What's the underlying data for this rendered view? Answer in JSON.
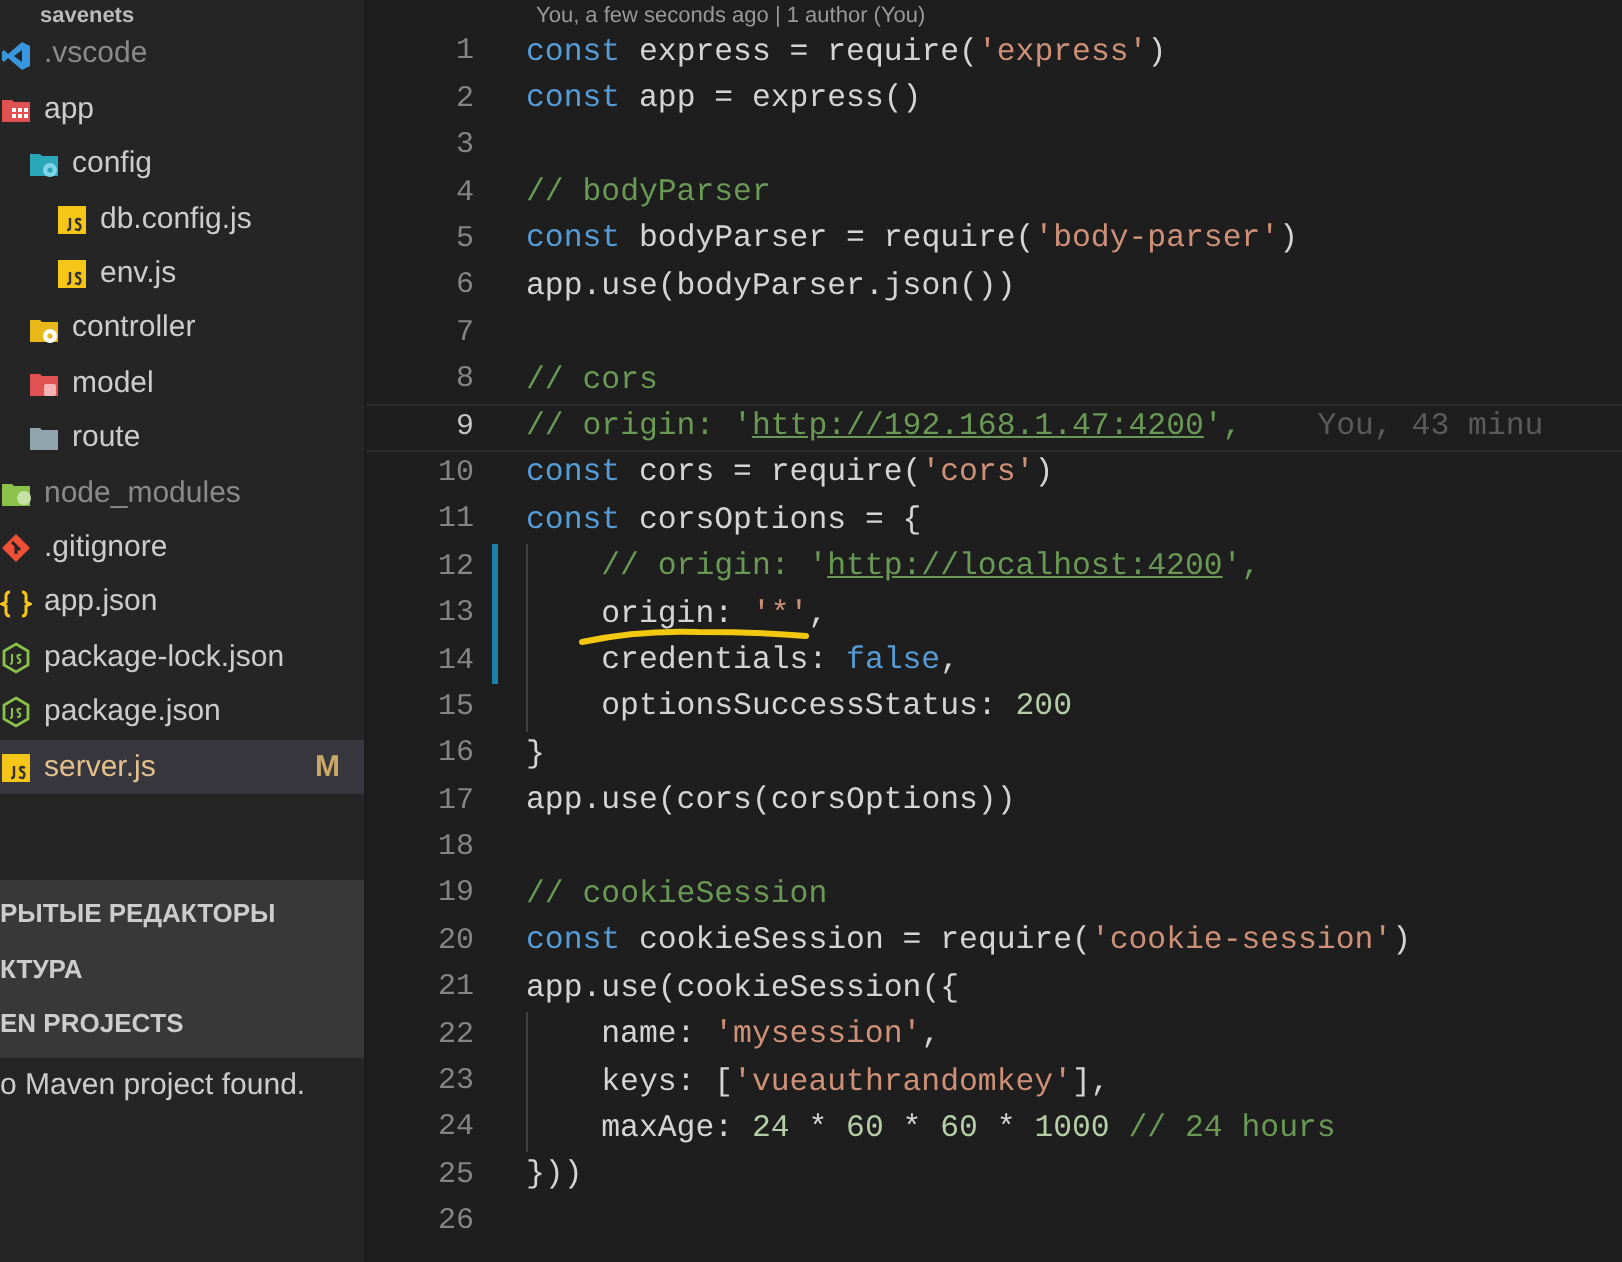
{
  "explorer": {
    "root": "savenets",
    "tree": [
      {
        "label": ".vscode",
        "kind": "vscode",
        "dimmed": true,
        "selected": false
      },
      {
        "label": "app",
        "kind": "folder-app",
        "dimmed": false,
        "selected": false,
        "children": [
          {
            "label": "config",
            "kind": "folder-config",
            "dimmed": false,
            "selected": false,
            "children": [
              {
                "label": "db.config.js",
                "kind": "js",
                "dimmed": false,
                "selected": false
              },
              {
                "label": "env.js",
                "kind": "js",
                "dimmed": false,
                "selected": false
              }
            ]
          },
          {
            "label": "controller",
            "kind": "folder-controller",
            "dimmed": false,
            "selected": false
          },
          {
            "label": "model",
            "kind": "folder-model",
            "dimmed": false,
            "selected": false
          },
          {
            "label": "route",
            "kind": "folder",
            "dimmed": false,
            "selected": false
          }
        ]
      },
      {
        "label": "node_modules",
        "kind": "folder-node",
        "dimmed": true,
        "selected": false
      },
      {
        "label": ".gitignore",
        "kind": "git",
        "dimmed": false,
        "selected": false
      },
      {
        "label": "app.json",
        "kind": "json",
        "dimmed": false,
        "selected": false
      },
      {
        "label": "package-lock.json",
        "kind": "npm",
        "dimmed": false,
        "selected": false
      },
      {
        "label": "package.json",
        "kind": "npm",
        "dimmed": false,
        "selected": false
      },
      {
        "label": "server.js",
        "kind": "js",
        "dimmed": false,
        "selected": true,
        "badge": "M"
      }
    ],
    "sections": [
      "РЫТЫЕ РЕДАКТОРЫ",
      "КТУРА",
      "EN PROJECTS"
    ],
    "maven_message": "o Maven project found."
  },
  "editor": {
    "codelens": "You, a few seconds ago | 1 author (You)",
    "lines": [
      {
        "number": "1",
        "current": false,
        "modified": false,
        "tokens": [
          {
            "kind": "kw",
            "text": "const"
          },
          {
            "kind": "plain",
            "text": " express = "
          },
          {
            "kind": "plain",
            "text": "require"
          },
          {
            "kind": "plain",
            "text": "("
          },
          {
            "kind": "str",
            "text": "'express'"
          },
          {
            "kind": "plain",
            "text": ")"
          }
        ]
      },
      {
        "number": "2",
        "current": false,
        "modified": false,
        "tokens": [
          {
            "kind": "kw",
            "text": "const"
          },
          {
            "kind": "plain",
            "text": " app = express()"
          }
        ]
      },
      {
        "number": "3",
        "current": false,
        "modified": false
      },
      {
        "number": "4",
        "current": false,
        "modified": false,
        "tokens": [
          {
            "kind": "com",
            "text": "// bodyParser"
          }
        ]
      },
      {
        "number": "5",
        "current": false,
        "modified": false,
        "tokens": [
          {
            "kind": "kw",
            "text": "const"
          },
          {
            "kind": "plain",
            "text": " bodyParser = require("
          },
          {
            "kind": "str",
            "text": "'body-parser'"
          },
          {
            "kind": "plain",
            "text": ")"
          }
        ]
      },
      {
        "number": "6",
        "current": false,
        "modified": false,
        "tokens": [
          {
            "kind": "plain",
            "text": "app.use(bodyParser.json())"
          }
        ]
      },
      {
        "number": "7",
        "current": false,
        "modified": false
      },
      {
        "number": "8",
        "current": false,
        "modified": false,
        "tokens": [
          {
            "kind": "com",
            "text": "// cors"
          }
        ]
      },
      {
        "number": "9",
        "current": true,
        "modified": false,
        "blame": "You, 43 minu",
        "tokens": [
          {
            "kind": "com",
            "text": "// origin: '"
          },
          {
            "kind": "link",
            "text": "http://192.168.1.47:4200"
          },
          {
            "kind": "com",
            "text": "',"
          }
        ]
      },
      {
        "number": "10",
        "current": false,
        "modified": false,
        "tokens": [
          {
            "kind": "kw",
            "text": "const"
          },
          {
            "kind": "plain",
            "text": " cors = require("
          },
          {
            "kind": "str",
            "text": "'cors'"
          },
          {
            "kind": "plain",
            "text": ")"
          }
        ]
      },
      {
        "number": "11",
        "current": false,
        "modified": false,
        "tokens": [
          {
            "kind": "kw",
            "text": "const"
          },
          {
            "kind": "plain",
            "text": " corsOptions = {"
          }
        ]
      },
      {
        "number": "12",
        "current": false,
        "modified": true,
        "indented": true,
        "tokens": [
          {
            "kind": "com",
            "text": "// origin: '"
          },
          {
            "kind": "link",
            "text": "http://localhost:4200"
          },
          {
            "kind": "com",
            "text": "',"
          }
        ]
      },
      {
        "number": "13",
        "current": false,
        "modified": true,
        "indented": true,
        "annotated": true,
        "tokens": [
          {
            "kind": "plain",
            "text": "origin: "
          },
          {
            "kind": "str",
            "text": "'*'"
          },
          {
            "kind": "plain",
            "text": ","
          }
        ]
      },
      {
        "number": "14",
        "current": false,
        "modified": true,
        "indented": true,
        "tokens": [
          {
            "kind": "plain",
            "text": "credentials: "
          },
          {
            "kind": "kw",
            "text": "false"
          },
          {
            "kind": "plain",
            "text": ","
          }
        ]
      },
      {
        "number": "15",
        "current": false,
        "modified": false,
        "indented": true,
        "tokens": [
          {
            "kind": "plain",
            "text": "optionsSuccessStatus: "
          },
          {
            "kind": "num",
            "text": "200"
          }
        ]
      },
      {
        "number": "16",
        "current": false,
        "modified": false,
        "tokens": [
          {
            "kind": "plain",
            "text": "}"
          }
        ]
      },
      {
        "number": "17",
        "current": false,
        "modified": false,
        "tokens": [
          {
            "kind": "plain",
            "text": "app.use(cors(corsOptions))"
          }
        ]
      },
      {
        "number": "18",
        "current": false,
        "modified": false
      },
      {
        "number": "19",
        "current": false,
        "modified": false,
        "tokens": [
          {
            "kind": "com",
            "text": "// cookieSession"
          }
        ]
      },
      {
        "number": "20",
        "current": false,
        "modified": false,
        "tokens": [
          {
            "kind": "kw",
            "text": "const"
          },
          {
            "kind": "plain",
            "text": " cookieSession = require("
          },
          {
            "kind": "str",
            "text": "'cookie-session'"
          },
          {
            "kind": "plain",
            "text": ")"
          }
        ]
      },
      {
        "number": "21",
        "current": false,
        "modified": false,
        "tokens": [
          {
            "kind": "plain",
            "text": "app.use(cookieSession({"
          }
        ]
      },
      {
        "number": "22",
        "current": false,
        "modified": false,
        "indented": true,
        "tokens": [
          {
            "kind": "plain",
            "text": "name: "
          },
          {
            "kind": "str",
            "text": "'mysession'"
          },
          {
            "kind": "plain",
            "text": ","
          }
        ]
      },
      {
        "number": "23",
        "current": false,
        "modified": false,
        "indented": true,
        "tokens": [
          {
            "kind": "plain",
            "text": "keys: ["
          },
          {
            "kind": "str",
            "text": "'vueauthrandomkey'"
          },
          {
            "kind": "plain",
            "text": "],"
          }
        ]
      },
      {
        "number": "24",
        "current": false,
        "modified": false,
        "indented": true,
        "tokens": [
          {
            "kind": "plain",
            "text": "maxAge: "
          },
          {
            "kind": "num",
            "text": "24"
          },
          {
            "kind": "plain",
            "text": " * "
          },
          {
            "kind": "num",
            "text": "60"
          },
          {
            "kind": "plain",
            "text": " * "
          },
          {
            "kind": "num",
            "text": "60"
          },
          {
            "kind": "plain",
            "text": " * "
          },
          {
            "kind": "num",
            "text": "1000"
          },
          {
            "kind": "com",
            "text": " // 24 hours"
          }
        ]
      },
      {
        "number": "25",
        "current": false,
        "modified": false,
        "tokens": [
          {
            "kind": "plain",
            "text": "}))"
          }
        ]
      },
      {
        "number": "26",
        "current": false,
        "modified": false
      }
    ]
  }
}
